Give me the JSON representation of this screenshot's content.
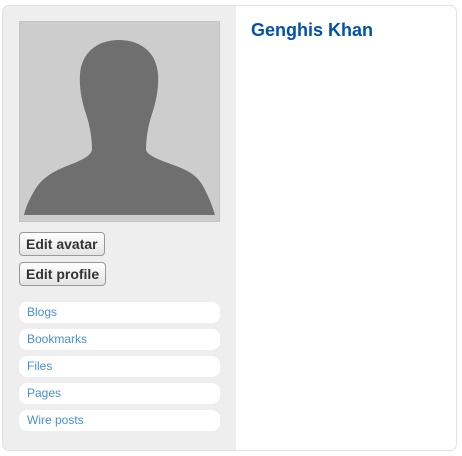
{
  "profile": {
    "name": "Genghis Khan"
  },
  "actions": {
    "edit_avatar": "Edit avatar",
    "edit_profile": "Edit profile"
  },
  "menu": {
    "items": [
      {
        "label": "Blogs"
      },
      {
        "label": "Bookmarks"
      },
      {
        "label": "Files"
      },
      {
        "label": "Pages"
      },
      {
        "label": "Wire posts"
      }
    ]
  },
  "colors": {
    "link": "#4690d6",
    "name": "#0054a7",
    "panel_bg": "#eeeeee",
    "avatar_bg": "#cdcdcd",
    "silhouette": "#6f6f6f"
  },
  "icons": {
    "avatar": "default-user-silhouette"
  }
}
